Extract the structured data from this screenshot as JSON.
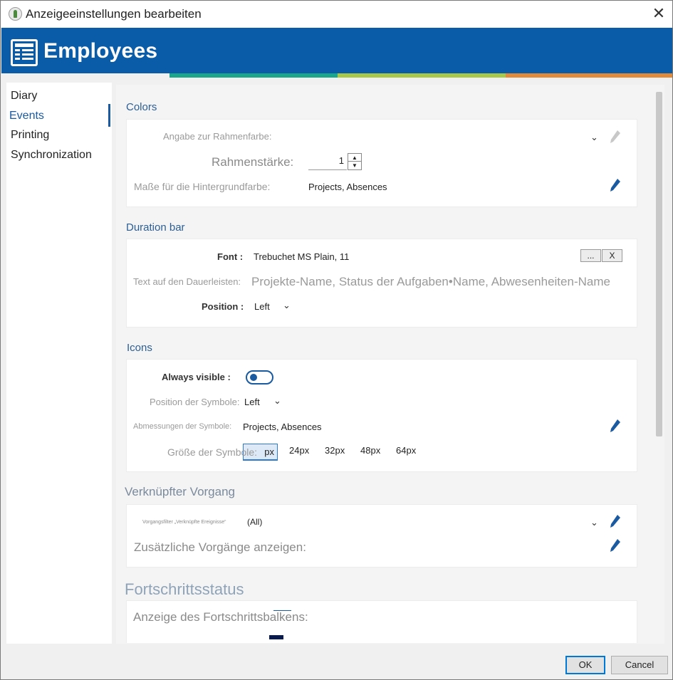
{
  "window": {
    "title": "Anzeigeeinstellungen bearbeiten"
  },
  "banner": {
    "title": "Employees"
  },
  "sidebar": {
    "items": [
      {
        "label": "Diary",
        "active": false
      },
      {
        "label": "Events",
        "active": true
      },
      {
        "label": "Printing",
        "active": false
      },
      {
        "label": "Synchronization",
        "active": false
      }
    ]
  },
  "colors": {
    "title": "Colors",
    "frame_color_label": "Angabe zur Rahmenfarbe:",
    "frame_thickness_label": "Rahmenstärke:",
    "frame_thickness_value": "1",
    "bg_color_label": "Maße für die Hintergrundfarbe:",
    "bg_color_value": "Projects, Absences"
  },
  "duration_bar": {
    "title": "Duration bar",
    "font_label": "Font :",
    "font_value": "Trebuchet MS Plain, 11",
    "font_browse_label": "...",
    "font_clear_label": "X",
    "text_label": "Text auf den Dauerleisten:",
    "text_value": "Projekte-Name, Status der Aufgaben•Name, Abwesenheiten-Name",
    "position_label": "Position :",
    "position_value": "Left"
  },
  "icons": {
    "title": "Icons",
    "always_visible_label": "Always visible :",
    "position_label": "Position der Symbole:",
    "position_value": "Left",
    "dimensions_label": "Abmessungen der Symbole:",
    "dimensions_value": "Projects, Absences",
    "size_label": "Größe der Symbole:",
    "size_selected": "px",
    "size_options": [
      "24px",
      "32px",
      "48px",
      "64px"
    ]
  },
  "linked": {
    "title": "Verknüpfter Vorgang",
    "filter_label": "Vorgangsfilter „Verknüpfte Ereignisse“",
    "filter_value": "(All)",
    "additional_label": "Zusätzliche Vorgänge anzeigen:"
  },
  "progress": {
    "title": "Fortschrittsstatus",
    "bar_label": "Anzeige des Fortschrittsbalkens:"
  },
  "buttons": {
    "ok": "OK",
    "cancel": "Cancel"
  },
  "theme": {
    "banner_color": "#0a5ca8",
    "accent_color": "#1a5aa0",
    "stripe_colors": [
      "#1aa68a",
      "#a8c84a",
      "#e08a3a"
    ]
  }
}
